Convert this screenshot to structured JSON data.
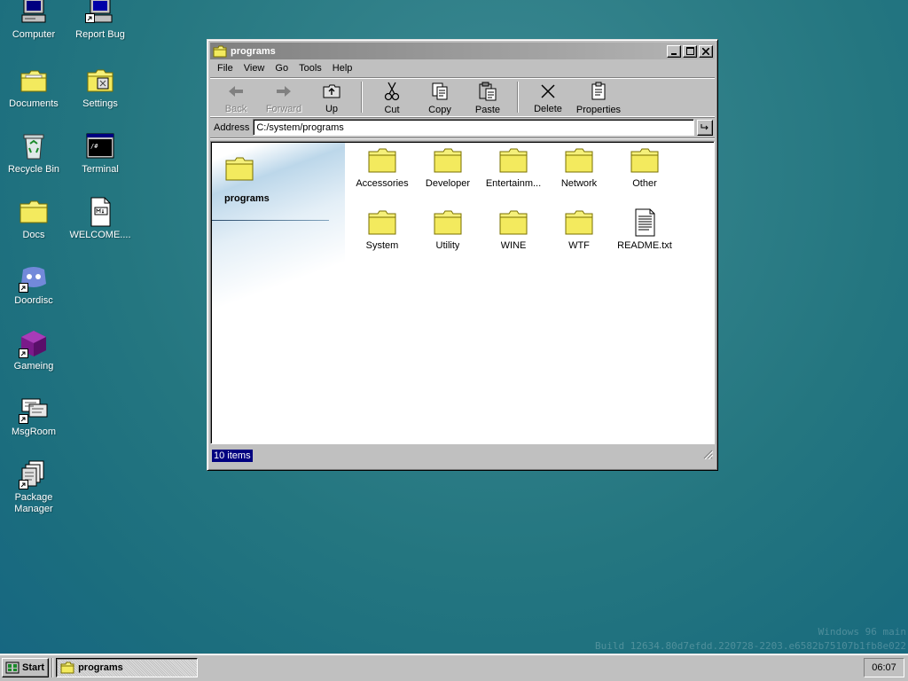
{
  "desktop": {
    "icons": [
      {
        "label": "Computer",
        "icon": "computer-icon"
      },
      {
        "label": "Report Bug",
        "icon": "report-bug-icon"
      },
      {
        "label": "Documents",
        "icon": "documents-folder-icon"
      },
      {
        "label": "Settings",
        "icon": "settings-icon"
      },
      {
        "label": "Recycle Bin",
        "icon": "recycle-bin-icon"
      },
      {
        "label": "Terminal",
        "icon": "terminal-icon"
      },
      {
        "label": "Docs",
        "icon": "folder-icon"
      },
      {
        "label": "WELCOME....",
        "icon": "markdown-file-icon"
      },
      {
        "label": "Doordisc",
        "icon": "doordisc-icon"
      },
      {
        "label": "Gameing",
        "icon": "gameing-cube-icon"
      },
      {
        "label": "MsgRoom",
        "icon": "msgroom-icon"
      },
      {
        "label": "Package Manager",
        "icon": "package-manager-icon"
      }
    ],
    "watermark": {
      "line1": "Windows 96 main",
      "line2": "Build 12634.80d7efdd.220728-2203.e6582b75107b1fb8e022"
    }
  },
  "window": {
    "title": "programs",
    "menu": [
      "File",
      "View",
      "Go",
      "Tools",
      "Help"
    ],
    "toolbar": {
      "back": "Back",
      "forward": "Forward",
      "up": "Up",
      "cut": "Cut",
      "copy": "Copy",
      "paste": "Paste",
      "delete": "Delete",
      "properties": "Properties"
    },
    "address": {
      "label": "Address",
      "value": "C:/system/programs"
    },
    "side_title": "programs",
    "items": [
      {
        "label": "Accessories",
        "type": "folder"
      },
      {
        "label": "Developer",
        "type": "folder"
      },
      {
        "label": "Entertainm...",
        "type": "folder"
      },
      {
        "label": "Network",
        "type": "folder"
      },
      {
        "label": "Other",
        "type": "folder"
      },
      {
        "label": "System",
        "type": "folder"
      },
      {
        "label": "Utility",
        "type": "folder"
      },
      {
        "label": "WINE",
        "type": "folder"
      },
      {
        "label": "WTF",
        "type": "folder"
      },
      {
        "label": "README.txt",
        "type": "text-file"
      }
    ],
    "status": "10 items"
  },
  "taskbar": {
    "start_label": "Start",
    "tasks": [
      {
        "label": "programs"
      }
    ],
    "clock": "06:07"
  },
  "colors": {
    "desktop": "#247680",
    "folder": "#f5f07a",
    "selection": "#000080",
    "window": "#c0c0c0"
  }
}
